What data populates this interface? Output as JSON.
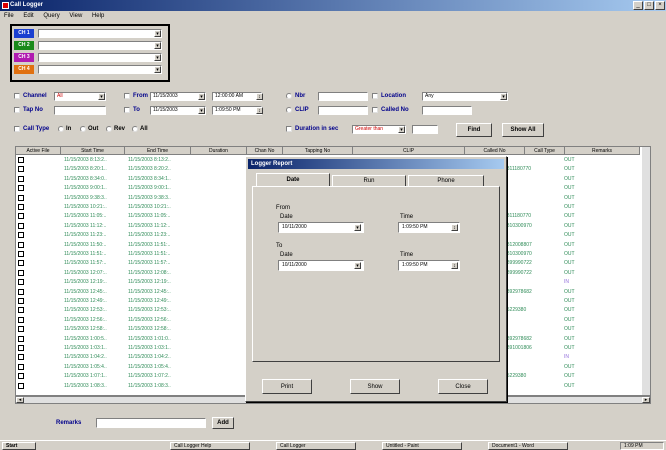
{
  "window": {
    "title": "Call Logger"
  },
  "menu": [
    "File",
    "Edit",
    "Query",
    "View",
    "Help"
  ],
  "channels": [
    {
      "label": "CH 1",
      "color": "#1a3fd0"
    },
    {
      "label": "CH 2",
      "color": "#1a8a1a"
    },
    {
      "label": "CH 3",
      "color": "#b01ab0"
    },
    {
      "label": "CH 4",
      "color": "#e07010"
    }
  ],
  "filters": {
    "channel_label": "Channel",
    "channel_value": "All",
    "tap_no_label": "Tap No",
    "call_type_label": "Call Type",
    "call_type_options": [
      "In",
      "Out",
      "Rev",
      "All"
    ],
    "from_label": "From",
    "from_date": "11/15/2003",
    "from_time": "12:00:00 AM",
    "to_label": "To",
    "to_date": "11/15/2003",
    "to_time": "1:09:50 PM",
    "nbr_label": "Nbr",
    "clip_label": "CLIP",
    "location_label": "Location",
    "location_value": "Any",
    "called_no_label": "Called No",
    "duration_label": "Duration in sec",
    "duration_value": "Greater than",
    "find_button": "Find",
    "show_all_button": "Show All"
  },
  "table": {
    "headers": [
      "Active File",
      "Start Time",
      "End Time",
      "Duration",
      "Chan No",
      "Tapping No",
      "CLIP",
      "Called No",
      "Call Type",
      "Remarks"
    ],
    "rows": [
      {
        "start": "11/15/2003 8:13:2..",
        "end": "11/15/2003 8:13:2..",
        "called": "",
        "type": "OUT"
      },
      {
        "start": "11/15/2003 8:20:1..",
        "end": "11/15/2003 8:20:2..",
        "called": "9811180770",
        "type": "OUT"
      },
      {
        "start": "11/15/2003 8:34:0..",
        "end": "11/15/2003 8:34:1..",
        "called": "",
        "type": "OUT"
      },
      {
        "start": "11/15/2003 9:00:1..",
        "end": "11/15/2003 9:00:1..",
        "called": "",
        "type": "OUT"
      },
      {
        "start": "11/15/2003 9:38:3..",
        "end": "11/15/2003 9:38:3..",
        "called": "",
        "type": "OUT"
      },
      {
        "start": "11/15/2003 10:21:..",
        "end": "11/15/2003 10:21:..",
        "called": "",
        "type": "OUT"
      },
      {
        "start": "11/15/2003 11:05:..",
        "end": "11/15/2003 11:05:..",
        "called": "9811180770",
        "type": "OUT"
      },
      {
        "start": "11/15/2003 11:12:..",
        "end": "11/15/2003 11:12:..",
        "called": "9810300970",
        "type": "OUT"
      },
      {
        "start": "11/15/2003 11:23:..",
        "end": "11/15/2003 11:23:..",
        "called": "",
        "type": "OUT"
      },
      {
        "start": "11/15/2003 11:50:..",
        "end": "11/15/2003 11:51:..",
        "called": "9812008807",
        "type": "OUT"
      },
      {
        "start": "11/15/2003 11:51:..",
        "end": "11/15/2003 11:51:..",
        "called": "9810300970",
        "type": "OUT"
      },
      {
        "start": "11/15/2003 11:57:..",
        "end": "11/15/2003 11:57:..",
        "called": "9899990722",
        "type": "OUT"
      },
      {
        "start": "11/15/2003 12:07:..",
        "end": "11/15/2003 12:08:..",
        "called": "9899990722",
        "type": "OUT"
      },
      {
        "start": "11/15/2003 12:19:..",
        "end": "11/15/2003 12:19:..",
        "called": "",
        "type": "IN"
      },
      {
        "start": "11/15/2003 12:45:..",
        "end": "11/15/2003 12:45:..",
        "called": "9892978682",
        "type": "OUT"
      },
      {
        "start": "11/15/2003 12:49:..",
        "end": "11/15/2003 12:49:..",
        "called": "0",
        "type": "OUT"
      },
      {
        "start": "11/15/2003 12:53:..",
        "end": "11/15/2003 12:53:..",
        "called": "95229380",
        "type": "OUT"
      },
      {
        "start": "11/15/2003 12:56:..",
        "end": "11/15/2003 12:56:..",
        "called": "",
        "type": "OUT"
      },
      {
        "start": "11/15/2003 12:58:..",
        "end": "11/15/2003 12:58:..",
        "called": "",
        "type": "OUT"
      },
      {
        "start": "11/15/2003 1:00:5..",
        "end": "11/15/2003 1:01:0..",
        "called": "9892978682",
        "type": "OUT"
      },
      {
        "start": "11/15/2003 1:03:1..",
        "end": "11/15/2003 1:03:1..",
        "called": "9891001806",
        "type": "OUT"
      },
      {
        "start": "11/15/2003 1:04:2..",
        "end": "11/15/2003 1:04:2..",
        "called": "",
        "type": "IN"
      },
      {
        "start": "11/15/2003 1:05:4..",
        "end": "11/15/2003 1:05:4..",
        "called": "",
        "type": "OUT"
      },
      {
        "start": "11/15/2003 1:07:1..",
        "end": "11/15/2003 1:07:2..",
        "called": "95229380",
        "type": "OUT"
      },
      {
        "start": "11/15/2003 1:08:3..",
        "end": "11/15/2003 1:08:3..",
        "called": "",
        "type": "OUT"
      }
    ]
  },
  "remarks": {
    "label": "Remarks",
    "add_button": "Add"
  },
  "dialog": {
    "title": "Logger Report",
    "tabs": [
      "Date",
      "Run",
      "Phone"
    ],
    "from_label": "From",
    "to_label": "To",
    "date_label": "Date",
    "time_label": "Time",
    "from_date": "10/11/2000",
    "from_time": "1:09:50 PM",
    "to_date": "10/11/2000",
    "to_time": "1:09:50 PM",
    "print_button": "Print",
    "show_button": "Show",
    "close_button": "Close"
  },
  "taskbar": {
    "start_label": "Start",
    "items": [
      "Call Logger Help",
      "Call Logger",
      "Untitled - Paint",
      "Document1 - Word"
    ],
    "clock": "1:09 PM"
  }
}
